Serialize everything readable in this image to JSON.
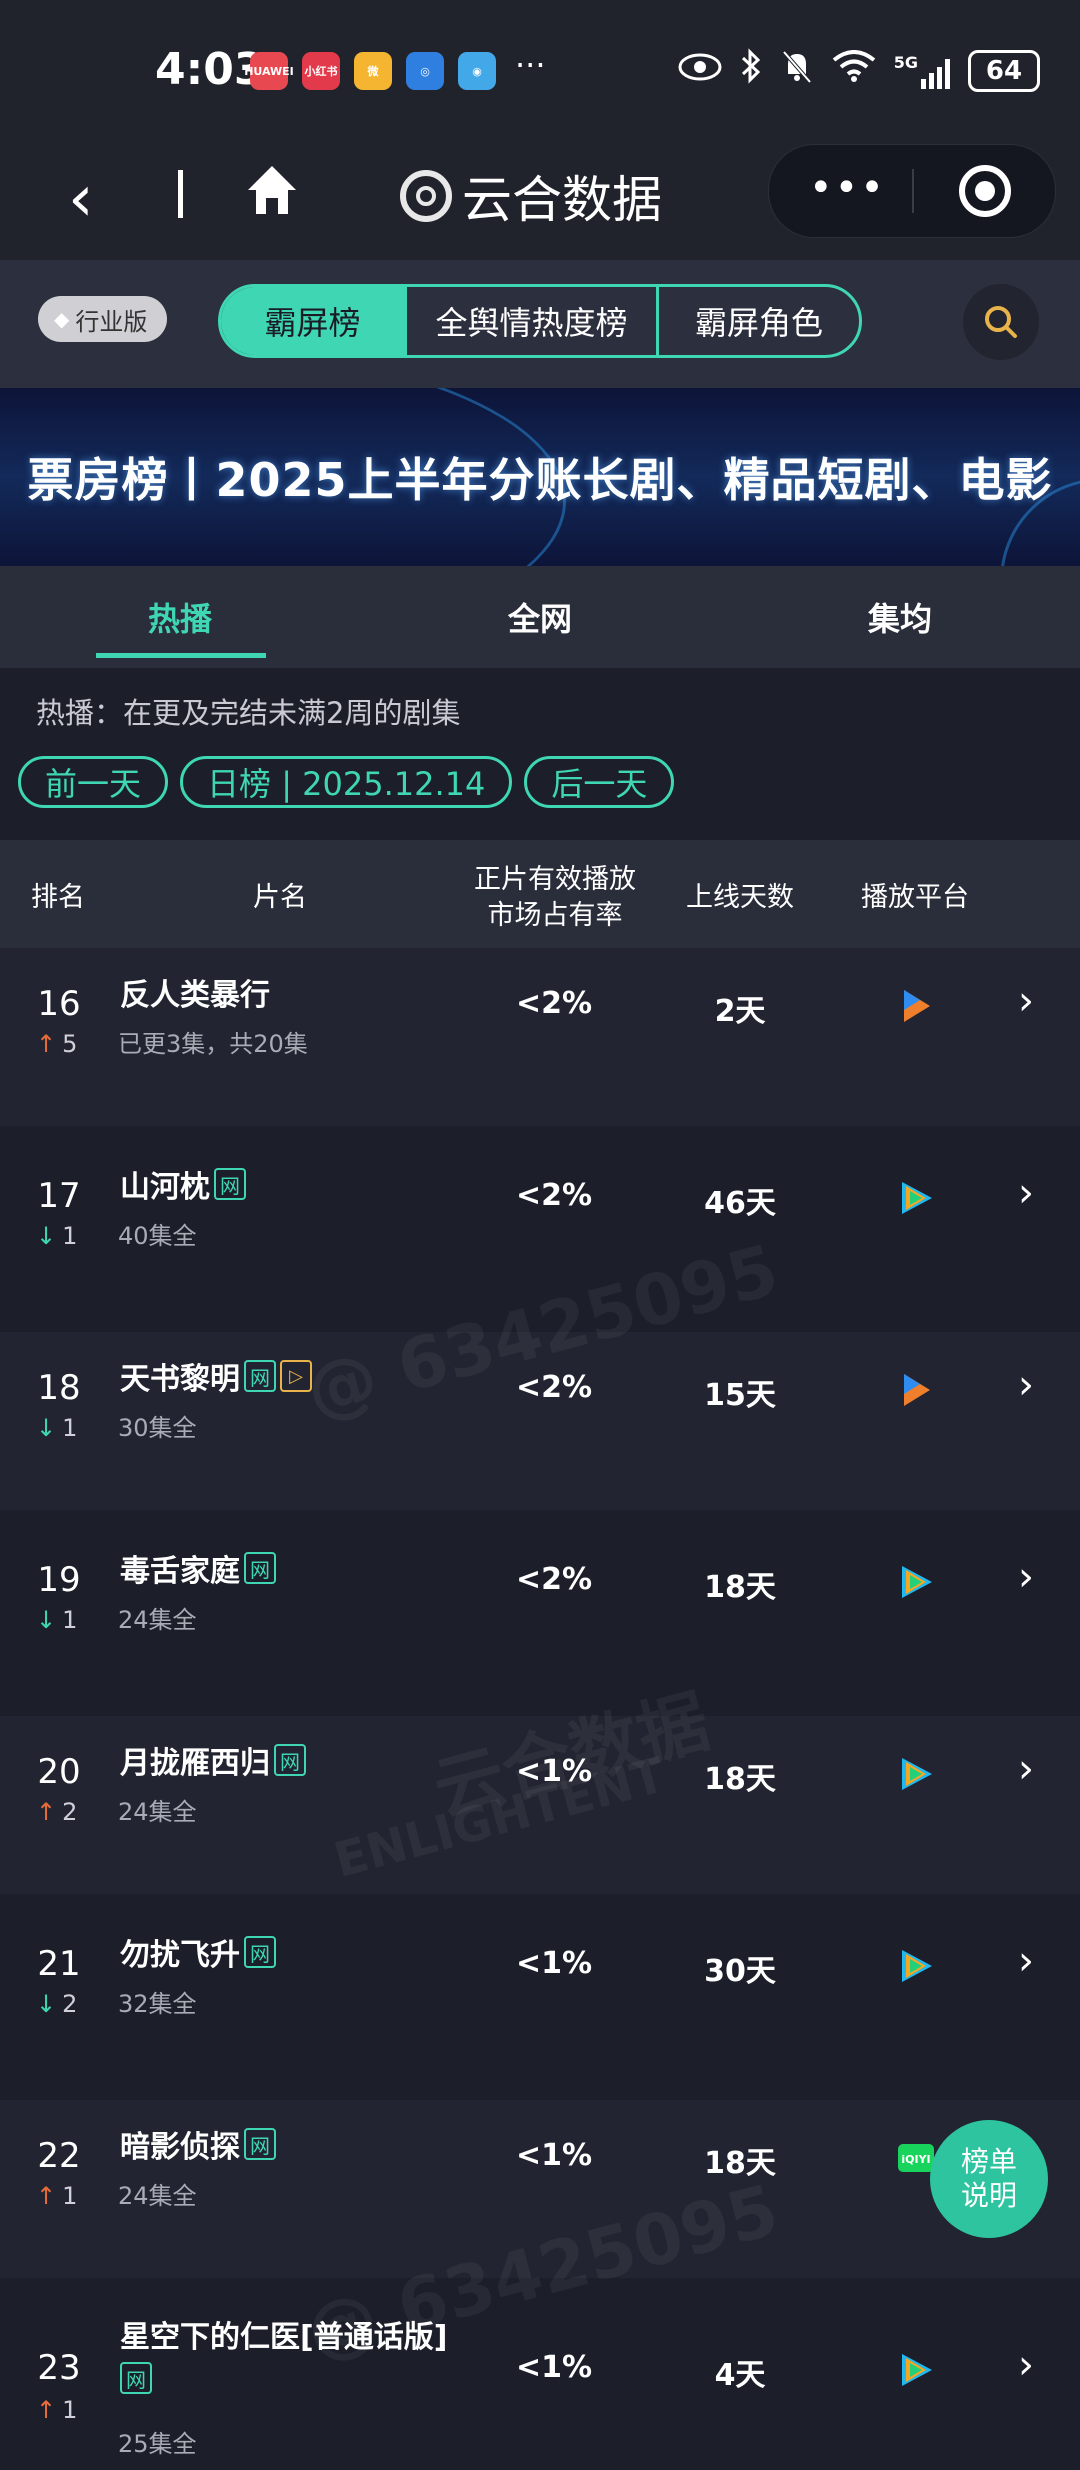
{
  "status_bar": {
    "time": "4:03",
    "apps": [
      {
        "name": "huawei-app",
        "label": "HUAWEI",
        "color": "#e8484f"
      },
      {
        "name": "xiaohongshu-app",
        "label": "小红书",
        "color": "#e23a4a"
      },
      {
        "name": "weibo-app",
        "label": "微",
        "color": "#f5b531"
      },
      {
        "name": "browser-app",
        "label": "◎",
        "color": "#2f7fe0"
      },
      {
        "name": "tieba-app",
        "label": "◉",
        "color": "#43a8e8"
      }
    ],
    "network": "5G",
    "battery": "64"
  },
  "nav": {
    "brand": "云合数据"
  },
  "category_bar": {
    "industry_badge": "行业版",
    "segments": [
      "霸屏榜",
      "全舆情热度榜",
      "霸屏角色"
    ],
    "active_segment": 0
  },
  "banner": {
    "title": "票房榜丨2025上半年分账长剧、精品短剧、电影"
  },
  "tabs": [
    "热播",
    "全网",
    "集均"
  ],
  "active_tab": 0,
  "description": "热播：在更及完结未满2周的剧集",
  "date_nav": {
    "prev": "前一天",
    "current": "日榜 | 2025.12.14",
    "next": "后一天"
  },
  "table_header": {
    "rank": "排名",
    "title": "片名",
    "share_line1": "正片有效播放",
    "share_line2": "市场占有率",
    "days": "上线天数",
    "platform": "播放平台"
  },
  "rows": [
    {
      "rank": "16",
      "trend": "up",
      "change": "5",
      "title": "反人类暴行",
      "tags": [],
      "sub": "已更3集，共20集",
      "share": "<2%",
      "days": "2天",
      "platform": "youku"
    },
    {
      "rank": "17",
      "trend": "down",
      "change": "1",
      "title": "山河枕",
      "tags": [
        "网"
      ],
      "sub": "40集全",
      "share": "<2%",
      "days": "46天",
      "platform": "tencent"
    },
    {
      "rank": "18",
      "trend": "down",
      "change": "1",
      "title": "天书黎明",
      "tags": [
        "网",
        "play"
      ],
      "sub": "30集全",
      "share": "<2%",
      "days": "15天",
      "platform": "youku"
    },
    {
      "rank": "19",
      "trend": "down",
      "change": "1",
      "title": "毒舌家庭",
      "tags": [
        "网"
      ],
      "sub": "24集全",
      "share": "<2%",
      "days": "18天",
      "platform": "tencent"
    },
    {
      "rank": "20",
      "trend": "up",
      "change": "2",
      "title": "月拢雁西归",
      "tags": [
        "网"
      ],
      "sub": "24集全",
      "share": "<1%",
      "days": "18天",
      "platform": "tencent"
    },
    {
      "rank": "21",
      "trend": "down",
      "change": "2",
      "title": "勿扰飞升",
      "tags": [
        "网"
      ],
      "sub": "32集全",
      "share": "<1%",
      "days": "30天",
      "platform": "tencent"
    },
    {
      "rank": "22",
      "trend": "up",
      "change": "1",
      "title": "暗影侦探",
      "tags": [
        "网"
      ],
      "sub": "24集全",
      "share": "<1%",
      "days": "18天",
      "platform": "iqiyi"
    },
    {
      "rank": "23",
      "trend": "up",
      "change": "1",
      "title": "星空下的仁医[普通话版]",
      "tags": [
        "网"
      ],
      "sub": "25集全",
      "share": "<1%",
      "days": "4天",
      "platform": "tencent"
    }
  ],
  "watermarks": [
    "@ 63425095",
    "云合数据",
    "ENLIGHTENT",
    "@ 63425095"
  ],
  "float_button": {
    "line1": "榜单",
    "line2": "说明"
  },
  "colors": {
    "accent": "#3fd7b3",
    "up": "#e86c3a",
    "down": "#3fd7b3",
    "background": "#1c1f2a"
  }
}
